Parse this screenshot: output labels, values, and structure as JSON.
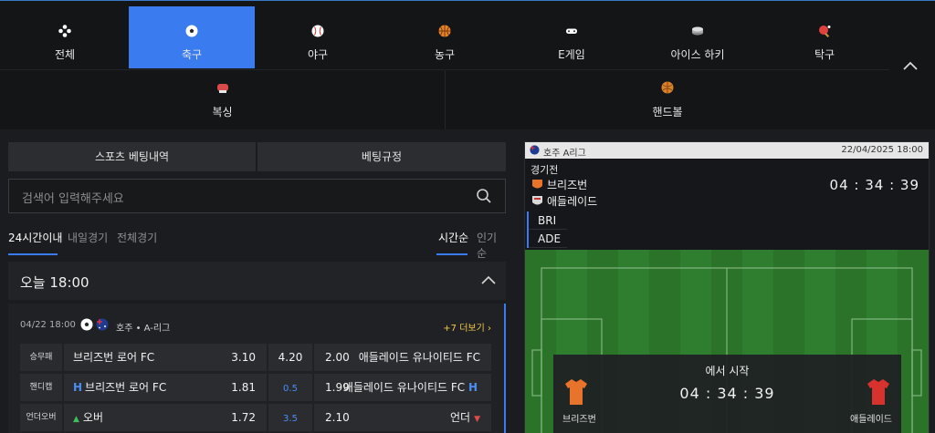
{
  "colors": {
    "accent": "#3a7bf0",
    "odds_link": "#f2c94c",
    "pitch": "#2f7d2f"
  },
  "sports_nav": {
    "items": [
      {
        "label": "전체",
        "icon": "all-sports-icon"
      },
      {
        "label": "축구",
        "icon": "soccer-ball-icon",
        "active": true
      },
      {
        "label": "야구",
        "icon": "baseball-icon"
      },
      {
        "label": "농구",
        "icon": "basketball-icon"
      },
      {
        "label": "E게임",
        "icon": "esports-gamepad-icon"
      },
      {
        "label": "아이스 하키",
        "icon": "hockey-puck-icon"
      },
      {
        "label": "탁구",
        "icon": "table-tennis-icon"
      },
      {
        "label": "복싱",
        "icon": "boxing-glove-icon"
      },
      {
        "label": "핸드볼",
        "icon": "handball-icon"
      }
    ]
  },
  "bet_tabs": {
    "history": "스포츠 베팅내역",
    "rules": "베팅규정"
  },
  "search": {
    "placeholder": "검색어 입력해주세요"
  },
  "filters": {
    "range": [
      "24시간이내",
      "내일경기",
      "전체경기"
    ],
    "sort": [
      "시간순",
      "인기순"
    ]
  },
  "group": {
    "title": "오늘 18:00"
  },
  "match": {
    "datetime": "04/22 18:00",
    "league": "호주 • A-리그",
    "more": "+7 더보기 ›",
    "rows": [
      {
        "label": "승무패",
        "home": "브리즈번 로어 FC",
        "home_odds": "3.10",
        "mid": "4.20",
        "away_odds": "2.00",
        "away": "애들레이드 유나이티드 FC"
      },
      {
        "label": "핸디캡",
        "home_badge": "H",
        "home": "브리즈번 로어 FC",
        "home_odds": "1.81",
        "mid": "0.5",
        "away_odds": "1.99",
        "away": "애들레이드 유나이티드 FC",
        "away_badge": "H"
      },
      {
        "label": "언더오버",
        "home_prefix": "▲",
        "home": "오버",
        "home_odds": "1.72",
        "mid": "3.5",
        "away_odds": "2.10",
        "away": "언더",
        "away_suffix": "▼"
      }
    ]
  },
  "live": {
    "league": "호주 A리그",
    "date": "22/04/2025 18:00",
    "state": "경기전",
    "home": "브리즈번",
    "away": "애들레이드",
    "clock": "04 : 34 : 39",
    "abbr_home": "BRI",
    "abbr_away": "ADE",
    "overlay_title": "에서 시작",
    "overlay_clock": "04 : 34 : 39",
    "overlay_home": "브리즈번",
    "overlay_away": "애들레이드"
  }
}
